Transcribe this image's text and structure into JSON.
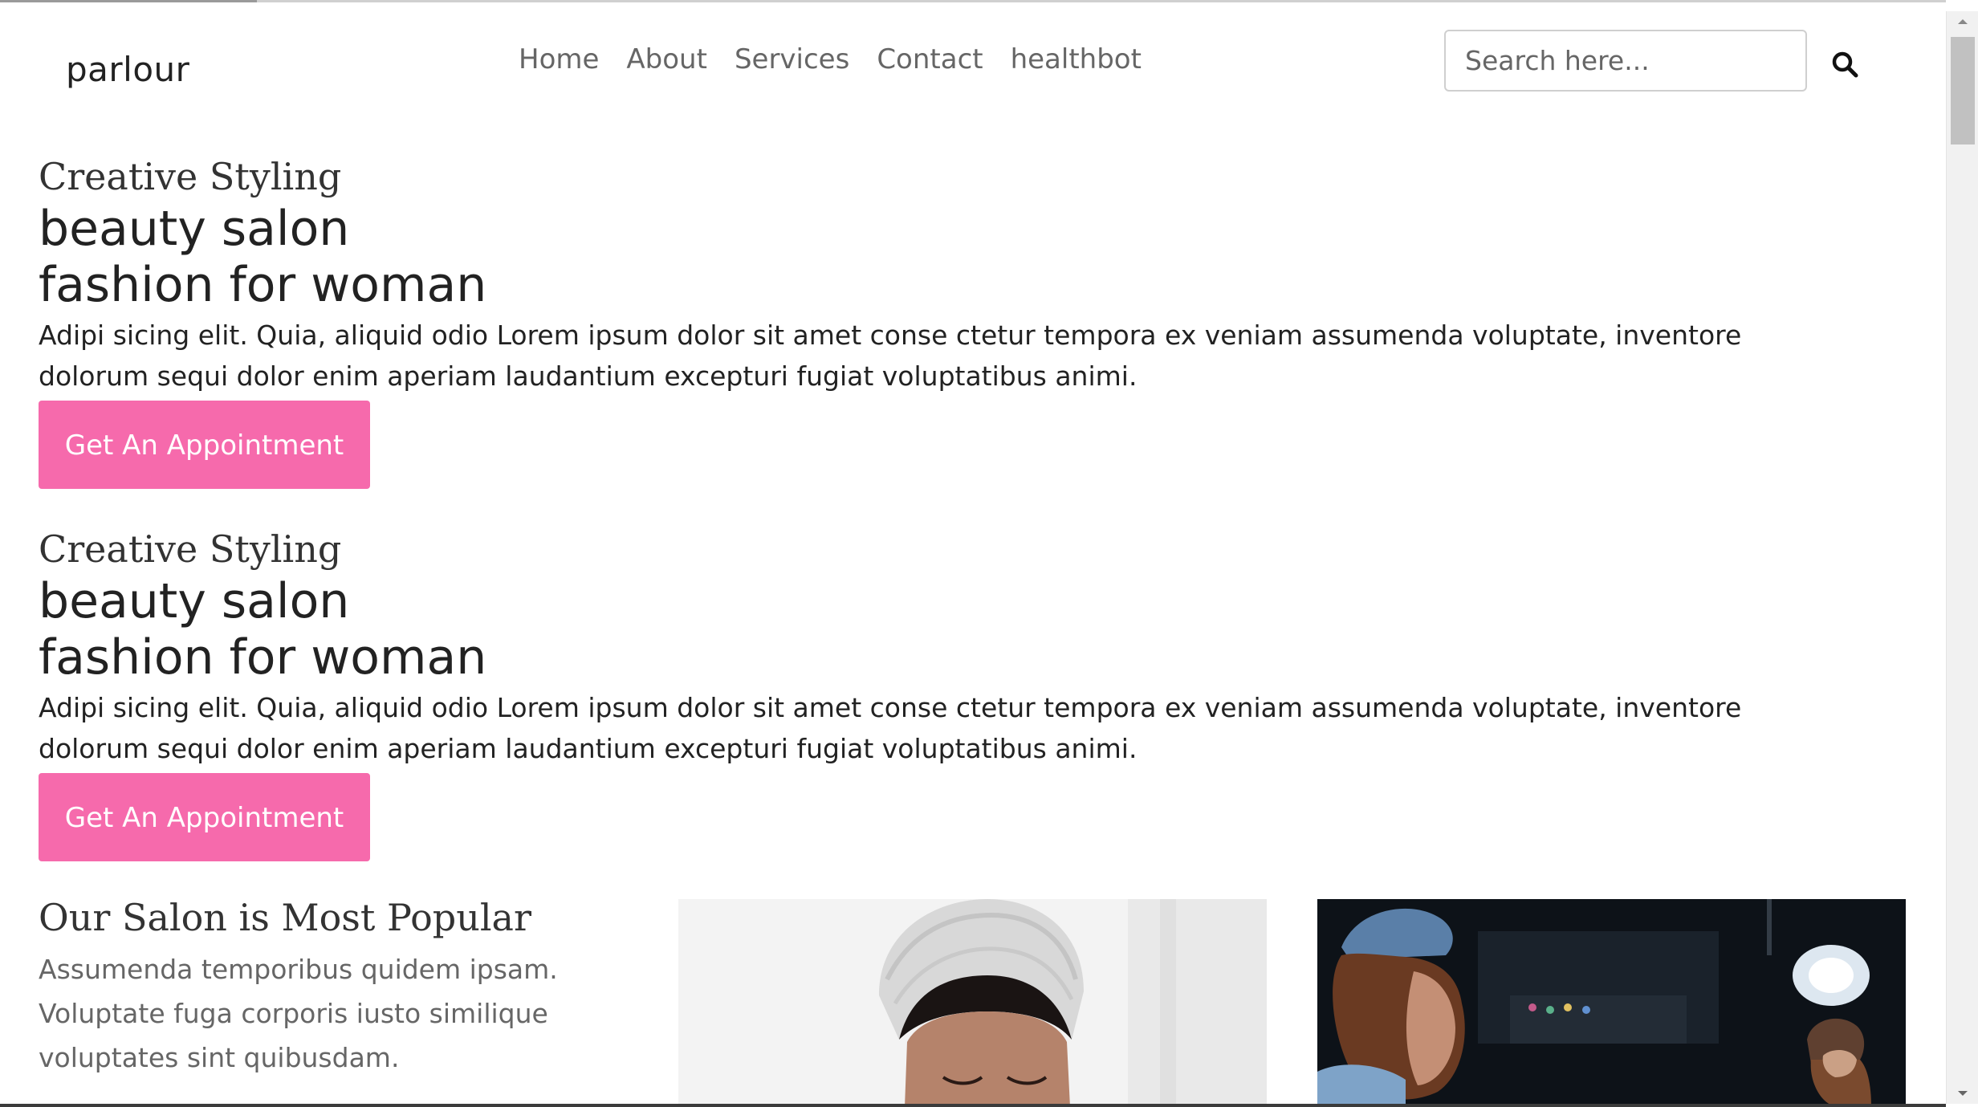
{
  "header": {
    "logo": "parlour",
    "nav": [
      "Home",
      "About",
      "Services",
      "Contact",
      "healthbot"
    ],
    "search_placeholder": "Search here..."
  },
  "heroes": [
    {
      "tagline": "Creative Styling",
      "title_line1": "beauty salon",
      "title_line2": "fashion for woman",
      "description": "Adipi sicing elit. Quia, aliquid odio Lorem ipsum dolor sit amet conse ctetur tempora ex veniam assumenda voluptate, inventore dolorum sequi dolor enim aperiam laudantium excepturi fugiat voluptatibus animi.",
      "button": "Get An Appointment"
    },
    {
      "tagline": "Creative Styling",
      "title_line1": "beauty salon",
      "title_line2": "fashion for woman",
      "description": "Adipi sicing elit. Quia, aliquid odio Lorem ipsum dolor sit amet conse ctetur tempora ex veniam assumenda voluptate, inventore dolorum sequi dolor enim aperiam laudantium excepturi fugiat voluptatibus animi.",
      "button": "Get An Appointment"
    }
  ],
  "popular": {
    "title": "Our Salon is Most Popular",
    "text": "Assumenda temporibus quidem ipsam. Voluptate fuga corporis iusto similique voluptates sint quibusdam."
  },
  "colors": {
    "accent_pink": "#f66aac",
    "nav_text": "#666666"
  },
  "icons": {
    "search": "search-icon",
    "scroll_up": "chevron-up-icon",
    "scroll_down": "chevron-down-icon"
  }
}
